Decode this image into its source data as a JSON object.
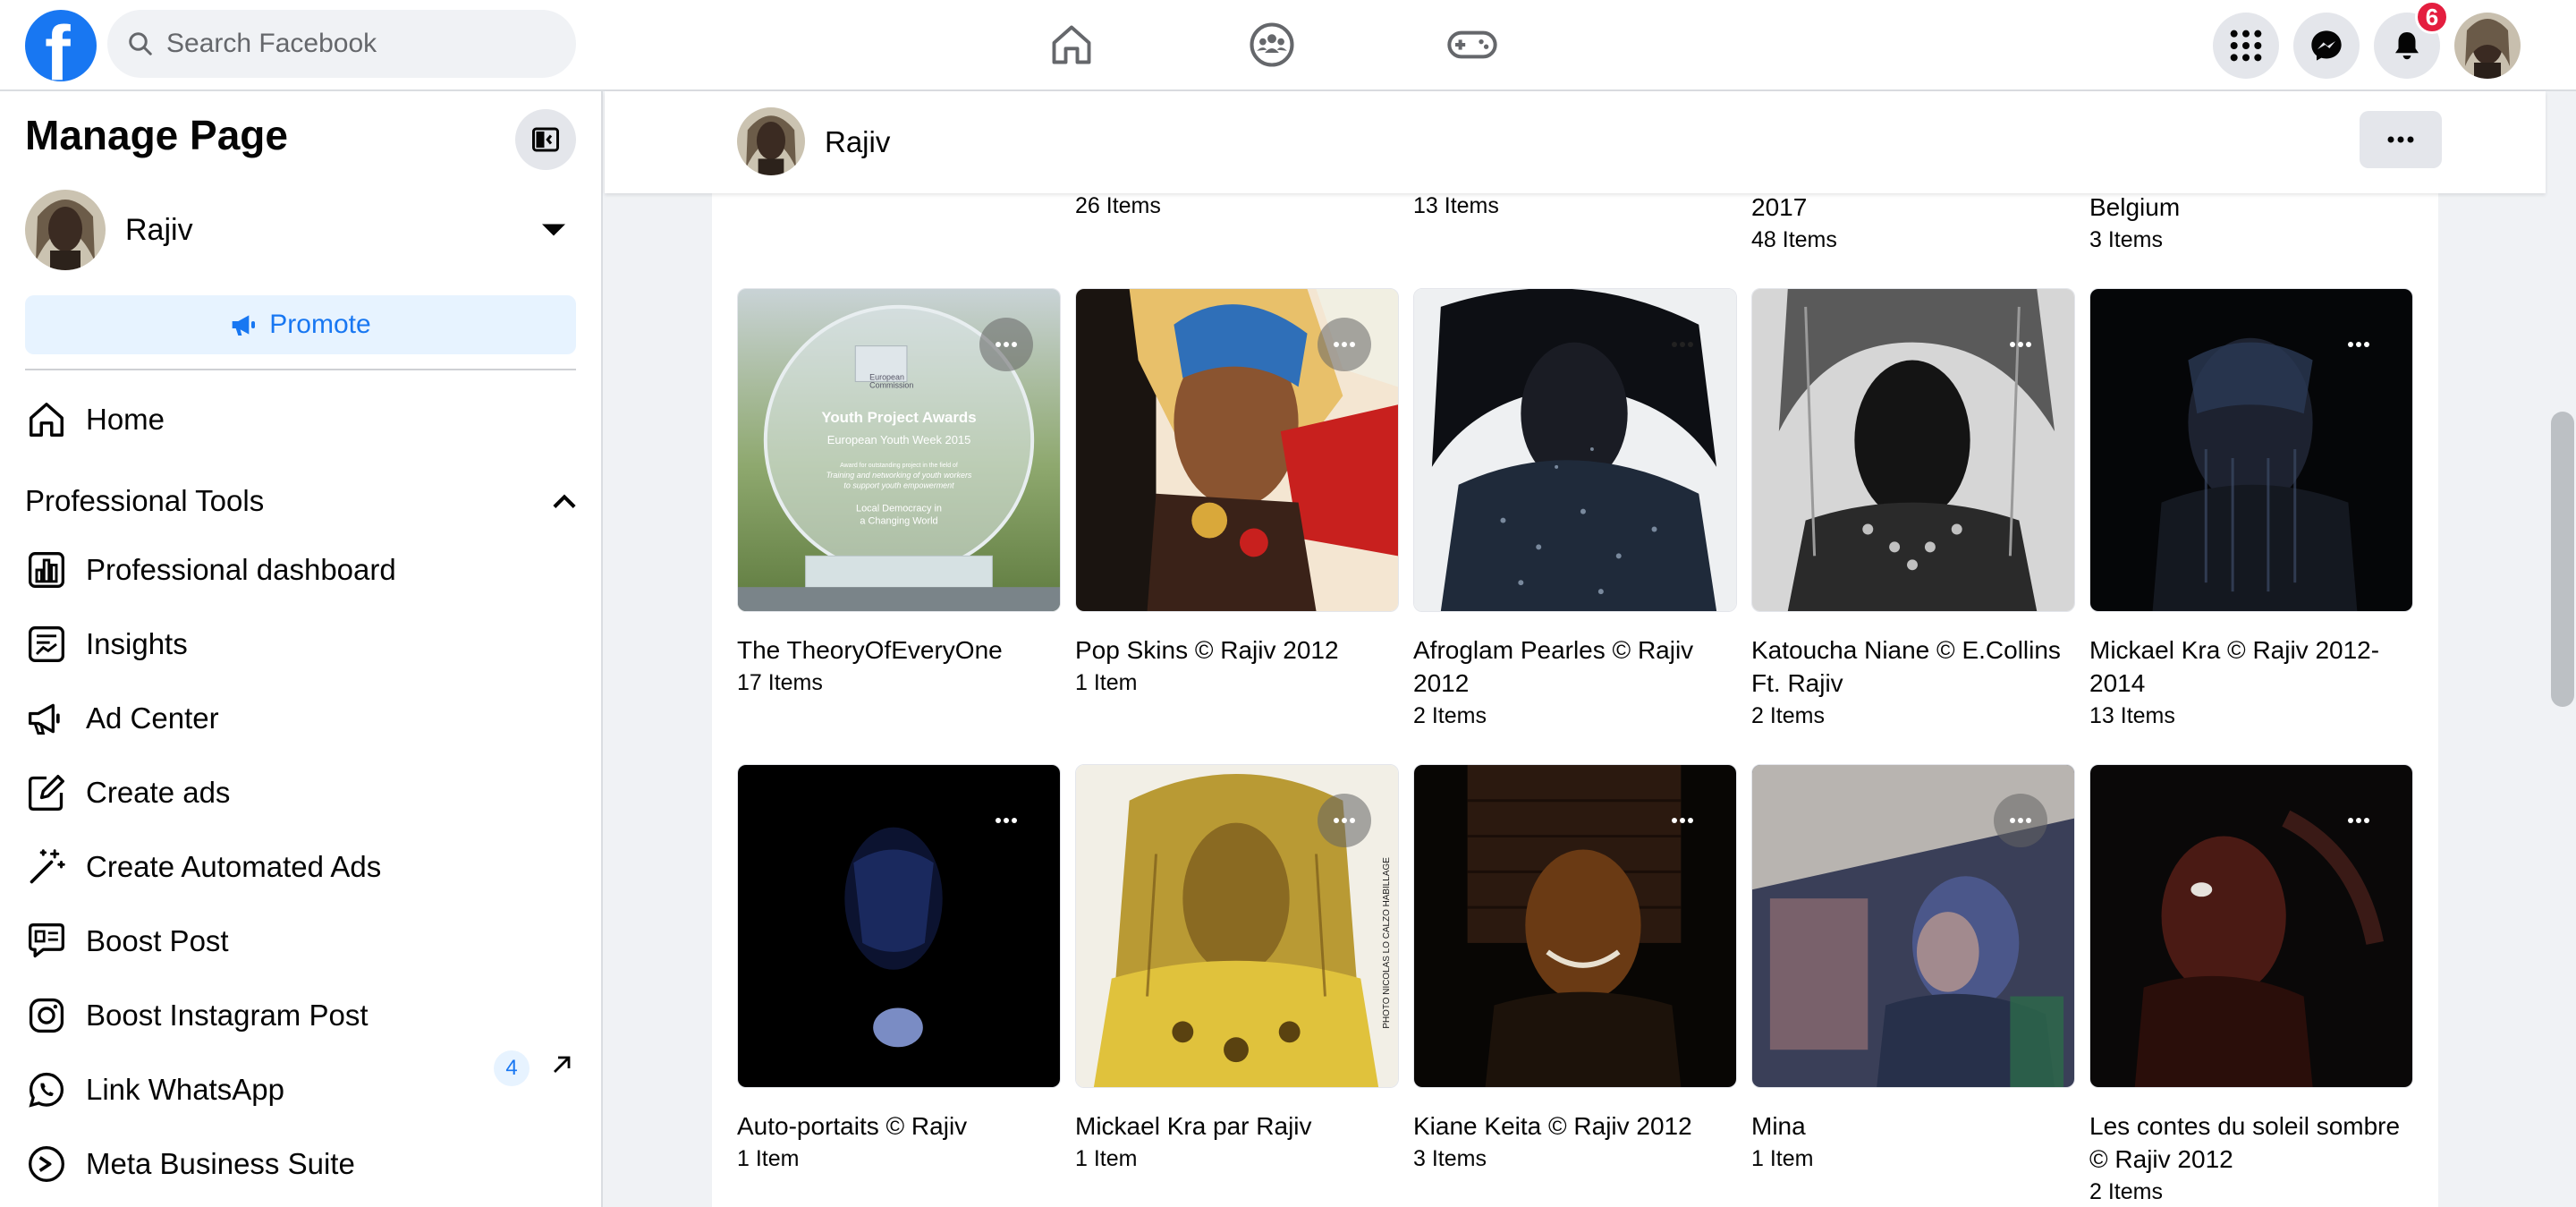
{
  "topbar": {
    "logo_letter": "f",
    "search_placeholder": "Search Facebook",
    "notification_count": "6",
    "nav": [
      "home-icon",
      "groups-icon",
      "gaming-icon"
    ],
    "right": [
      "menu-grid-icon",
      "messenger-icon",
      "bell-icon",
      "profile-avatar"
    ]
  },
  "sidebar": {
    "title": "Manage Page",
    "page_name": "Rajiv",
    "promote_label": "Promote",
    "home_label": "Home",
    "section_label": "Professional Tools",
    "items": [
      {
        "label": "Professional dashboard",
        "icon": "dashboard-icon"
      },
      {
        "label": "Insights",
        "icon": "insights-icon"
      },
      {
        "label": "Ad Center",
        "icon": "megaphone-icon"
      },
      {
        "label": "Create ads",
        "icon": "pencil-icon"
      },
      {
        "label": "Create Automated Ads",
        "icon": "magic-wand-icon"
      },
      {
        "label": "Boost Post",
        "icon": "boost-post-icon"
      },
      {
        "label": "Boost Instagram Post",
        "icon": "instagram-icon"
      },
      {
        "label": "Link WhatsApp",
        "icon": "whatsapp-icon"
      },
      {
        "label": "Meta Business Suite",
        "icon": "meta-business-icon"
      }
    ],
    "business_suite_count": "4"
  },
  "header": {
    "page_name": "Rajiv"
  },
  "previous_row": [
    {
      "title_tail": "",
      "items": "26 Items"
    },
    {
      "title_tail": "",
      "items": "13 Items"
    },
    {
      "title_tail": "2017",
      "items": "48 Items"
    },
    {
      "title_tail": "Belgium",
      "items": "3 Items"
    }
  ],
  "albums": [
    {
      "title": "The TheoryOfEveryOne",
      "items": "17 Items"
    },
    {
      "title": "Pop Skins © Rajiv 2012",
      "items": "1 Item"
    },
    {
      "title": "Afroglam Pearles © Rajiv 2012",
      "items": "2 Items"
    },
    {
      "title": "Katoucha Niane © E.Collins Ft. Rajiv",
      "items": "2 Items"
    },
    {
      "title": "Mickael Kra © Rajiv 2012-2014",
      "items": "13 Items"
    },
    {
      "title": "Auto-portaits © Rajiv",
      "items": "1 Item"
    },
    {
      "title": "Mickael Kra par Rajiv",
      "items": "1 Item"
    },
    {
      "title": "Kiane Keita © Rajiv 2012",
      "items": "3 Items"
    },
    {
      "title": "Mina",
      "items": "1 Item"
    },
    {
      "title": "Les contes du soleil sombre © Rajiv 2012",
      "items": "2 Items"
    }
  ],
  "award": {
    "line1": "European",
    "line2": "Commission",
    "headline": "Youth Project Awards",
    "subhead": "European Youth Week 2015",
    "body1": "Award for outstanding project in the field of",
    "body2": "Training and networking of youth workers",
    "body3": "to support youth empowerment",
    "body4": "Local Democracy in",
    "body5": "a Changing World"
  },
  "photo_credit": "PHOTO NICOLAS LO CALZO HABILLAGE",
  "colors": {
    "brand": "#1877f2",
    "badge": "#e41e3f",
    "promote_bg": "#e7f3ff"
  }
}
